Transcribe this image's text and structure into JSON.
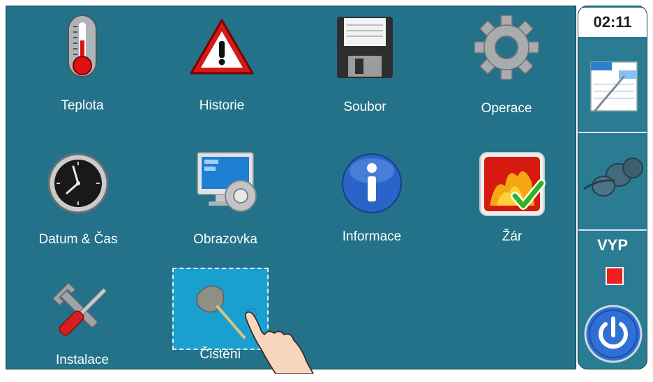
{
  "clock": "02:11",
  "status": "VYP",
  "tiles": {
    "teplota": {
      "label": "Teplota",
      "icon": "thermometer-icon"
    },
    "historie": {
      "label": "Historie",
      "icon": "warning-triangle-icon"
    },
    "soubor": {
      "label": "Soubor",
      "icon": "floppy-disk-icon"
    },
    "operace": {
      "label": "Operace",
      "icon": "gear-icon"
    },
    "datum": {
      "label": "Datum & Čas",
      "icon": "clock-icon"
    },
    "obrazovka": {
      "label": "Obrazovka",
      "icon": "display-settings-icon"
    },
    "informace": {
      "label": "Informace",
      "icon": "info-icon"
    },
    "zar": {
      "label": "Žár",
      "icon": "fire-check-icon"
    },
    "instalace": {
      "label": "Instalace",
      "icon": "tools-icon"
    },
    "cisteni": {
      "label": "Čistění",
      "icon": "duster-icon"
    }
  },
  "sidebar_icons": [
    "clipboard-pen-icon",
    "blower-icon",
    "stop-indicator-icon",
    "power-icon"
  ],
  "colors": {
    "background": "#237289",
    "selected": "#1aa0ce",
    "stop": "#ef1f1f",
    "power": "#2f6fd6"
  }
}
